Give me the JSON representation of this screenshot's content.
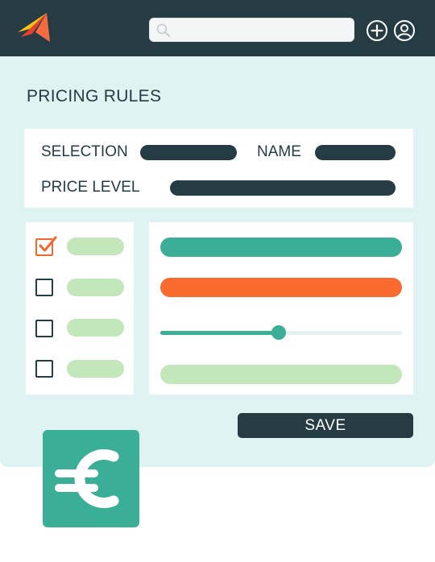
{
  "header": {
    "search": {
      "value": "",
      "placeholder": "",
      "icon": "search-icon"
    },
    "actions": [
      {
        "icon": "plus-circle-icon"
      },
      {
        "icon": "user-circle-icon"
      }
    ],
    "logo": "paper-plane-logo"
  },
  "page": {
    "title": "PRICING RULES"
  },
  "form": {
    "selection_label": "SELECTION",
    "name_label": "NAME",
    "price_level_label": "PRICE LEVEL"
  },
  "options": [
    {
      "checked": true
    },
    {
      "checked": false
    },
    {
      "checked": false
    },
    {
      "checked": false
    }
  ],
  "slider": {
    "value": 0.49
  },
  "save_label": "SAVE",
  "badge": {
    "icon": "euro-icon"
  },
  "colors": {
    "navy": "#253c45",
    "teal": "#3aae97",
    "orange": "#f86a2e",
    "light_green": "#c3e6bb",
    "background": "#e0f3f3"
  }
}
